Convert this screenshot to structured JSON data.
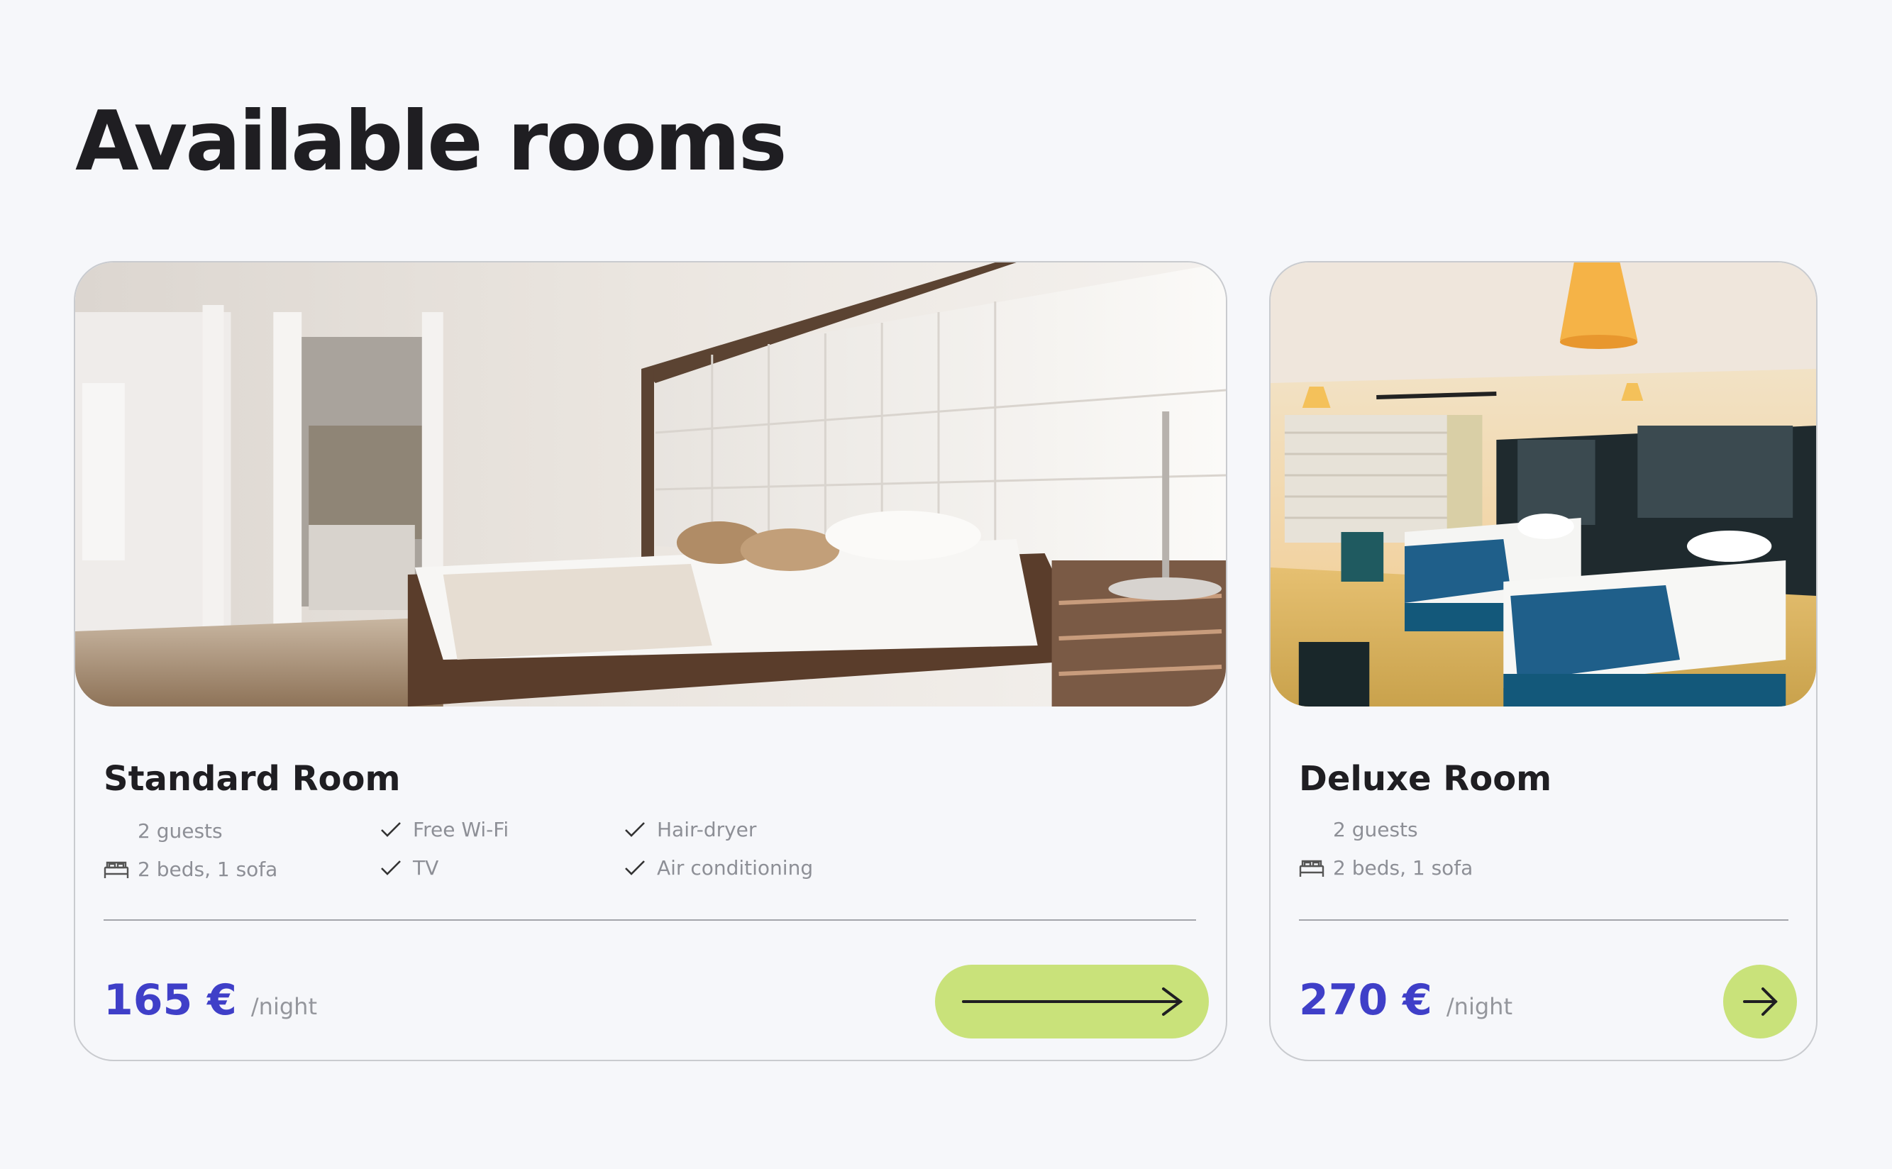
{
  "page": {
    "title": "Available rooms"
  },
  "rooms": [
    {
      "name": "Standard Room",
      "guests": "2 guests",
      "beds": "2 beds, 1 sofa",
      "amenities": [
        "Free Wi-Fi",
        "TV",
        "Hair-dryer",
        "Air conditioning"
      ],
      "price": "165 €",
      "price_unit": "/night"
    },
    {
      "name": "Deluxe Room",
      "guests": "2 guests",
      "beds": "2 beds, 1 sofa",
      "price": "270 €",
      "price_unit": "/night"
    }
  ],
  "icons": {
    "bed": "bed-icon",
    "check": "check-icon",
    "arrow": "arrow-right-icon"
  },
  "colors": {
    "background": "#f6f7fa",
    "price": "#3f3fc8",
    "button": "#c9e27a",
    "text": "#1f1e22",
    "muted": "#8d8f96"
  }
}
